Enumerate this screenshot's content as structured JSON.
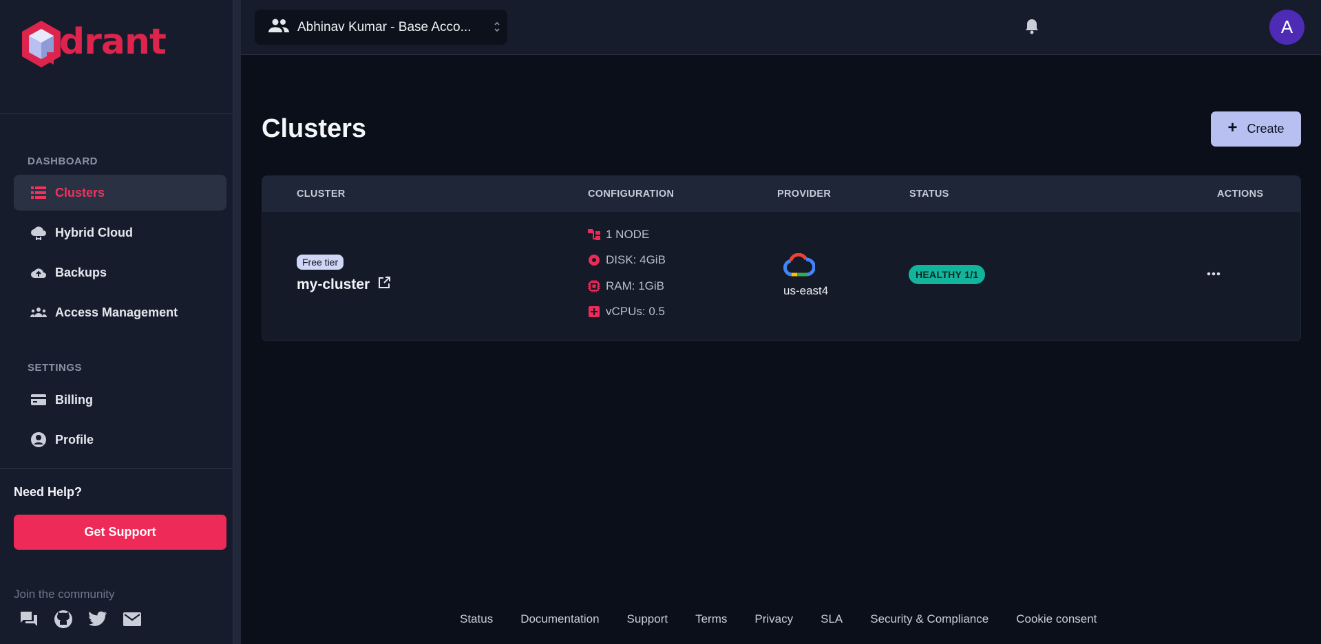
{
  "brand": {
    "name": "drant",
    "accent": "#dc244c"
  },
  "sidebar": {
    "sections": [
      {
        "label": "DASHBOARD"
      },
      {
        "label": "SETTINGS"
      }
    ],
    "items": [
      {
        "label": "Clusters",
        "icon": "list-icon",
        "active": true
      },
      {
        "label": "Hybrid Cloud",
        "icon": "cloud-sync-icon"
      },
      {
        "label": "Backups",
        "icon": "cloud-upload-icon"
      },
      {
        "label": "Access Management",
        "icon": "group-icon"
      },
      {
        "label": "Billing",
        "icon": "credit-card-icon"
      },
      {
        "label": "Profile",
        "icon": "account-circle-icon"
      }
    ],
    "help_title": "Need Help?",
    "support_label": "Get Support",
    "community_label": "Join the community",
    "community_icons": [
      "forum-icon",
      "github-icon",
      "twitter-icon",
      "mail-icon"
    ]
  },
  "topbar": {
    "account_name": "Abhinav Kumar - Base Acco...",
    "avatar_letter": "A"
  },
  "main": {
    "title": "Clusters",
    "create_label": "Create",
    "table": {
      "headers": [
        "CLUSTER",
        "CONFIGURATION",
        "PROVIDER",
        "STATUS",
        "ACTIONS"
      ],
      "rows": [
        {
          "tier": "Free tier",
          "name": "my-cluster",
          "config": [
            "1 NODE",
            "DISK: 4GiB",
            "RAM: 1GiB",
            "vCPUs: 0.5"
          ],
          "provider_region": "us-east4",
          "provider_icon": "google-cloud-icon",
          "status": "HEALTHY 1/1"
        }
      ]
    }
  },
  "footer": {
    "links": [
      "Status",
      "Documentation",
      "Support",
      "Terms",
      "Privacy",
      "SLA",
      "Security & Compliance",
      "Cookie consent"
    ]
  }
}
